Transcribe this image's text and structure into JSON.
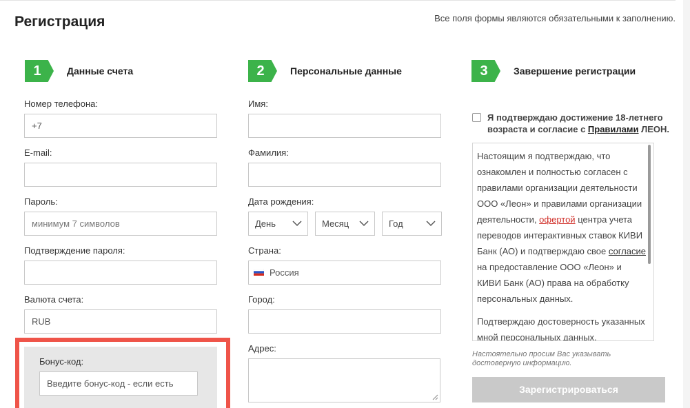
{
  "header": {
    "title": "Регистрация",
    "note": "Все поля формы являются обязательными к заполнению."
  },
  "steps": [
    {
      "number": "1",
      "title": "Данные счета"
    },
    {
      "number": "2",
      "title": "Персональные данные"
    },
    {
      "number": "3",
      "title": "Завершение регистрации"
    }
  ],
  "account": {
    "phone_label": "Номер телефона:",
    "phone_value": "+7",
    "email_label": "E-mail:",
    "email_value": "",
    "password_label": "Пароль:",
    "password_placeholder": "минимум 7 символов",
    "confirm_label": "Подтверждение пароля:",
    "confirm_value": "",
    "currency_label": "Валюта счета:",
    "currency_value": "RUB",
    "bonus_label": "Бонус-код:",
    "bonus_placeholder": "Введите бонус-код - если есть"
  },
  "personal": {
    "name_label": "Имя:",
    "surname_label": "Фамилия:",
    "birth_label": "Дата рождения:",
    "day": "День",
    "month": "Месяц",
    "year": "Год",
    "country_label": "Страна:",
    "country_value": "Россия",
    "city_label": "Город:",
    "address_label": "Адрес:"
  },
  "finish": {
    "consent_part1": "Я подтверждаю достижение 18-летнего возраста и согласие с ",
    "consent_link": "Правилами",
    "consent_part2": " ЛЕОН.",
    "terms_p1_a": "Настоящим я подтверждаю, что ознакомлен и полностью согласен с правилами организации деятельности ООО «Леон» и правилами организации деятельности, ",
    "terms_p1_link": "офертой",
    "terms_p1_b": " центра учета переводов интерактивных ставок КИВИ Банк (АО) и подтверждаю свое ",
    "terms_p1_link2": "согласие",
    "terms_p1_c": " на предоставление ООО «Леон» и КИВИ Банк (АО) права на обработку персональных данных.",
    "terms_p2": "Подтверждаю достоверность указанных мной персональных данных.",
    "small_note": "Настоятельно просим Вас указывать достоверную информацию.",
    "submit_label": "Зарегистрироваться"
  },
  "colors": {
    "accent_green": "#3cb34a",
    "highlight_red": "#ef5449",
    "link_red": "#d0302a",
    "button_disabled": "#c9c9c9"
  }
}
